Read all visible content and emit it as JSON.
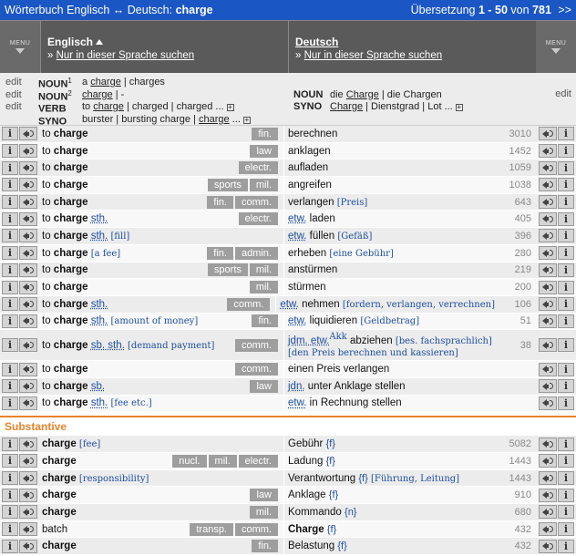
{
  "topbar": {
    "title": "Wörterbuch Englisch ↔ Deutsch:",
    "query": "charge",
    "results_prefix": "Übersetzung",
    "results_range": "1 - 50",
    "results_suffix": "von",
    "results_total": "781",
    "next": ">>"
  },
  "header": {
    "menu_label": "MENU",
    "left_title": "Englisch",
    "left_sub": "Nur in dieser Sprache suchen",
    "right_title": "Deutsch",
    "right_sub": "Nur in dieser Sprache suchen",
    "arrow": "»"
  },
  "headword": {
    "left": [
      {
        "edit": "edit",
        "pos": "NOUN",
        "sup": "1",
        "pre": "a",
        "u": "charge",
        "post": " | charges"
      },
      {
        "edit": "edit",
        "pos": "NOUN",
        "sup": "2",
        "pre": "",
        "u": "charge",
        "post": " | -"
      },
      {
        "edit": "edit",
        "pos": "VERB",
        "sup": "",
        "pre": "to",
        "u": "charge",
        "post": " | charged | charged ..."
      },
      {
        "edit": "",
        "pos": "SYNO",
        "sup": "",
        "pre": "burster | bursting charge |",
        "u": "charge",
        "post": " ..."
      }
    ],
    "right": [
      {
        "pos": "NOUN",
        "pre": "die",
        "u": "Charge",
        "post": " | die Chargen"
      },
      {
        "pos": "SYNO",
        "pre": "",
        "u": "Charge",
        "post": " | Dienstgrad | Lot ..."
      }
    ],
    "right_edit": "edit"
  },
  "icons": {
    "info": "i"
  },
  "rows": [
    {
      "en_pre": "to ",
      "en_b": "charge",
      "en_rest": "",
      "en_hint": "",
      "tags": [
        "fin."
      ],
      "de": "berechnen",
      "de_hint": "",
      "count": "3010"
    },
    {
      "en_pre": "to ",
      "en_b": "charge",
      "en_rest": "",
      "en_hint": "",
      "tags": [
        "law"
      ],
      "de": "anklagen",
      "de_hint": "",
      "count": "1452"
    },
    {
      "en_pre": "to ",
      "en_b": "charge",
      "en_rest": "",
      "en_hint": "",
      "tags": [
        "electr."
      ],
      "de": "aufladen",
      "de_hint": "",
      "count": "1059"
    },
    {
      "en_pre": "to ",
      "en_b": "charge",
      "en_rest": "",
      "en_hint": "",
      "tags": [
        "sports",
        "mil."
      ],
      "de": "angreifen",
      "de_hint": "",
      "count": "1038"
    },
    {
      "en_pre": "to ",
      "en_b": "charge",
      "en_rest": "",
      "en_hint": "",
      "tags": [
        "fin.",
        "comm."
      ],
      "de": "verlangen",
      "de_hint": "[Preis]",
      "count": "643"
    },
    {
      "en_pre": "to ",
      "en_b": "charge",
      "en_rest": "sth.",
      "en_hint": "",
      "tags": [
        "electr."
      ],
      "de_etw": "etw.",
      "de": "laden",
      "de_hint": "",
      "count": "405"
    },
    {
      "en_pre": "to ",
      "en_b": "charge",
      "en_rest": "sth.",
      "en_hint": "[fill]",
      "tags": [],
      "de_etw": "etw.",
      "de": "füllen",
      "de_hint": "[Gefäß]",
      "count": "396"
    },
    {
      "en_pre": "to ",
      "en_b": "charge",
      "en_rest": "",
      "en_hint": "[a fee]",
      "tags": [
        "fin.",
        "admin."
      ],
      "de": "erheben",
      "de_hint": "[eine Gebühr]",
      "count": "280"
    },
    {
      "en_pre": "to ",
      "en_b": "charge",
      "en_rest": "",
      "en_hint": "",
      "tags": [
        "sports",
        "mil."
      ],
      "de": "anstürmen",
      "de_hint": "",
      "count": "219"
    },
    {
      "en_pre": "to ",
      "en_b": "charge",
      "en_rest": "",
      "en_hint": "",
      "tags": [
        "mil."
      ],
      "de": "stürmen",
      "de_hint": "",
      "count": "200"
    },
    {
      "en_pre": "to ",
      "en_b": "charge",
      "en_rest": "sth.",
      "en_hint": "",
      "tags": [
        "comm."
      ],
      "de_etw": "etw.",
      "de": "nehmen",
      "de_hint": "[fordern, verlangen, verrechnen]",
      "count": "106"
    },
    {
      "en_pre": "to ",
      "en_b": "charge",
      "en_rest": "sth.",
      "en_hint": "[amount of money]",
      "tags": [
        "fin."
      ],
      "de_etw": "etw.",
      "de": "liquidieren",
      "de_hint": "[Geldbetrag]",
      "count": "51"
    },
    {
      "tall": true,
      "en_pre": "to ",
      "en_b": "charge",
      "en_rest": "sb. sth.",
      "en_hint": "[demand payment]",
      "tags": [
        "comm."
      ],
      "de_etw": "jdm. etw.",
      "de_sup": "Akk",
      "de": "abziehen",
      "de_hint": "[bes. fachsprachlich] [den Preis berechnen und kassieren]",
      "count": "38"
    },
    {
      "en_pre": "to ",
      "en_b": "charge",
      "en_rest": "",
      "en_hint": "",
      "tags": [
        "comm."
      ],
      "de": "einen Preis verlangen",
      "de_hint": "",
      "count": ""
    },
    {
      "en_pre": "to ",
      "en_b": "charge",
      "en_rest": "sb.",
      "en_hint": "",
      "tags": [
        "law"
      ],
      "de_etw": "jdn.",
      "de": "unter Anklage stellen",
      "de_hint": "",
      "count": ""
    },
    {
      "en_pre": "to ",
      "en_b": "charge",
      "en_rest": "sth.",
      "en_hint": "[fee etc.]",
      "tags": [],
      "de_etw": "etw.",
      "de": "in Rechnung stellen",
      "de_hint": "",
      "count": ""
    }
  ],
  "section_title": "Substantive",
  "nouns": [
    {
      "en_pre": "",
      "en_b": "charge",
      "en_rest": "",
      "en_hint": "[fee]",
      "tags": [],
      "de": "Gebühr",
      "de_gen": "{f}",
      "de_hint": "",
      "count": "5082"
    },
    {
      "en_pre": "",
      "en_b": "charge",
      "en_rest": "",
      "en_hint": "",
      "tags": [
        "nucl.",
        "mil.",
        "electr."
      ],
      "de": "Ladung",
      "de_gen": "{f}",
      "de_hint": "",
      "count": "1443"
    },
    {
      "en_pre": "",
      "en_b": "charge",
      "en_rest": "",
      "en_hint": "[responsibility]",
      "tags": [],
      "de": "Verantwortung",
      "de_gen": "{f}",
      "de_hint": "[Führung, Leitung]",
      "count": "1443"
    },
    {
      "en_pre": "",
      "en_b": "charge",
      "en_rest": "",
      "en_hint": "",
      "tags": [
        "law"
      ],
      "de": "Anklage",
      "de_gen": "{f}",
      "de_hint": "",
      "count": "910"
    },
    {
      "en_pre": "",
      "en_b": "charge",
      "en_rest": "",
      "en_hint": "",
      "tags": [
        "mil."
      ],
      "de": "Kommando",
      "de_gen": "{n}",
      "de_hint": "",
      "count": "680"
    },
    {
      "en_pre": "batch",
      "en_b": "",
      "en_rest": "",
      "en_hint": "",
      "tags": [
        "transp.",
        "comm."
      ],
      "de": "Charge",
      "de_bold": true,
      "de_gen": "{f}",
      "de_hint": "",
      "count": "432"
    },
    {
      "en_pre": "",
      "en_b": "charge",
      "en_rest": "",
      "en_hint": "",
      "tags": [
        "fin."
      ],
      "de": "Belastung",
      "de_gen": "{f}",
      "de_hint": "",
      "count": "432"
    }
  ]
}
